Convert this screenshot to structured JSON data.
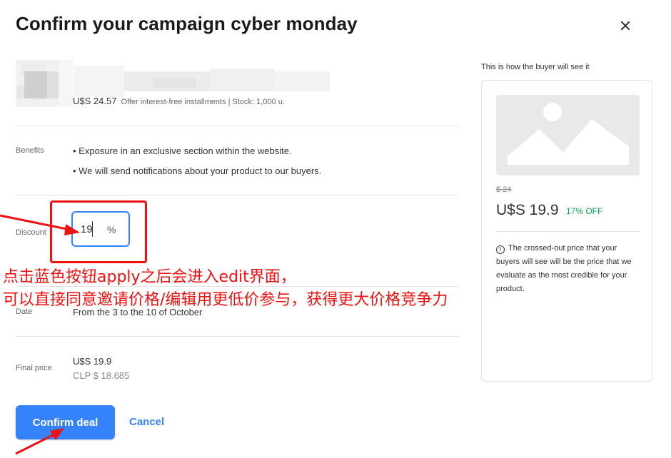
{
  "dialog": {
    "title": "Confirm your campaign cyber monday",
    "close_icon": "close-icon"
  },
  "product": {
    "price": "U$S 24.57",
    "price_note": "Offer interest-free installments | Stock: 1,000 u."
  },
  "benefits": {
    "label": "Benefits",
    "items": [
      "• Exposure in an exclusive section within the website.",
      "• We will send notifications about your product to our buyers."
    ]
  },
  "discount": {
    "label": "Discount",
    "value": "19",
    "unit": "%"
  },
  "date": {
    "label": "Date",
    "value": "From the 3 to the 10 of October"
  },
  "final_price": {
    "label": "Final price",
    "usd": "U$S 19.9",
    "clp": "CLP $ 18.685"
  },
  "actions": {
    "confirm_label": "Confirm deal",
    "cancel_label": "Cancel"
  },
  "preview": {
    "title": "This is how the buyer will see it",
    "image_icon": "image-placeholder-icon",
    "old_price": "$ 24",
    "new_price": "U$S 19.9",
    "off_label": "17% OFF",
    "info_icon": "info-icon",
    "info_symbol": "!",
    "info_text": "The crossed-out price that your buyers will see will be the price that we evaluate as the most credible for your product."
  },
  "annotation": {
    "line1": "点击蓝色按钮apply之后会进入edit界面，",
    "line2": "可以直接同意邀请价格/编辑用更低价参与，获得更大价格竞争力"
  },
  "colors": {
    "accent": "#3483fa",
    "discount_green": "#00a650",
    "annotation_red": "#ee1111"
  }
}
